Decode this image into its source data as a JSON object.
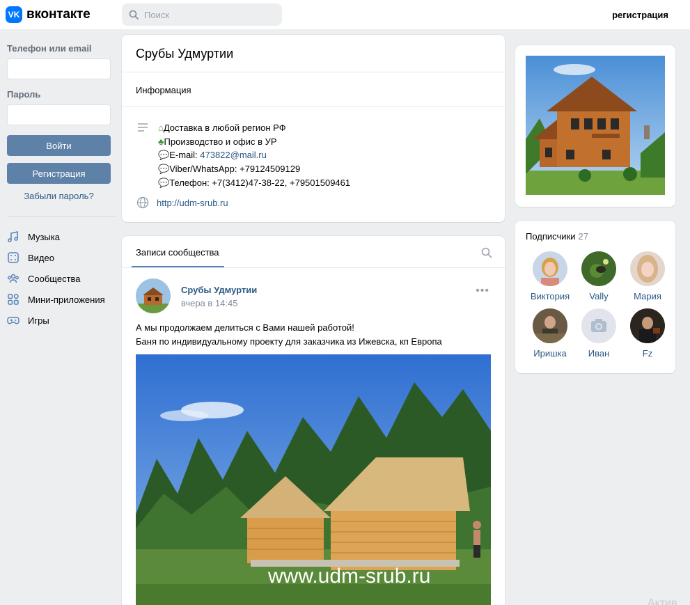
{
  "header": {
    "logo_badge": "VK",
    "logo_text": "вконтакте",
    "search_placeholder": "Поиск",
    "register_link": "регистрация"
  },
  "login": {
    "phone_label": "Телефон или email",
    "password_label": "Пароль",
    "login_button": "Войти",
    "register_button": "Регистрация",
    "forgot_link": "Забыли пароль?"
  },
  "nav": {
    "items": [
      {
        "label": "Музыка",
        "icon": "music-icon"
      },
      {
        "label": "Видео",
        "icon": "video-icon"
      },
      {
        "label": "Сообщества",
        "icon": "communities-icon"
      },
      {
        "label": "Мини-приложения",
        "icon": "mini-apps-icon"
      },
      {
        "label": "Игры",
        "icon": "games-icon"
      }
    ]
  },
  "community": {
    "title": "Срубы Удмуртии",
    "info_section": "Информация",
    "info": {
      "line1": "Доставка в любой регион РФ",
      "line2": "Производство и офис в УР",
      "email_prefix": "E-mail: ",
      "email": "473822@mail.ru",
      "line4": "Viber/WhatsApp: +79124509129",
      "line5": "Телефон: +7(3412)47-38-22, +79501509461"
    },
    "site": "http://udm-srub.ru"
  },
  "wall": {
    "tab": "Записи сообщества",
    "post": {
      "author": "Срубы Удмуртии",
      "time": "вчера в 14:45",
      "line1": "А мы продолжаем делиться с Вами нашей работой!",
      "line2": "Баня по индивидуальному проекту для заказчика из Ижевска, кп Европа",
      "image_watermark": "www.udm-srub.ru"
    }
  },
  "subscribers": {
    "title": "Подписчики",
    "count": "27",
    "people": [
      {
        "name": "Виктория"
      },
      {
        "name": "Vally"
      },
      {
        "name": "Мария"
      },
      {
        "name": "Иришка"
      },
      {
        "name": "Иван"
      },
      {
        "name": "Fz"
      }
    ]
  },
  "watermark": "Актив",
  "colors": {
    "accent": "#0077ff",
    "button": "#5e81a8",
    "link": "#2a5885",
    "background": "#edeef0"
  }
}
